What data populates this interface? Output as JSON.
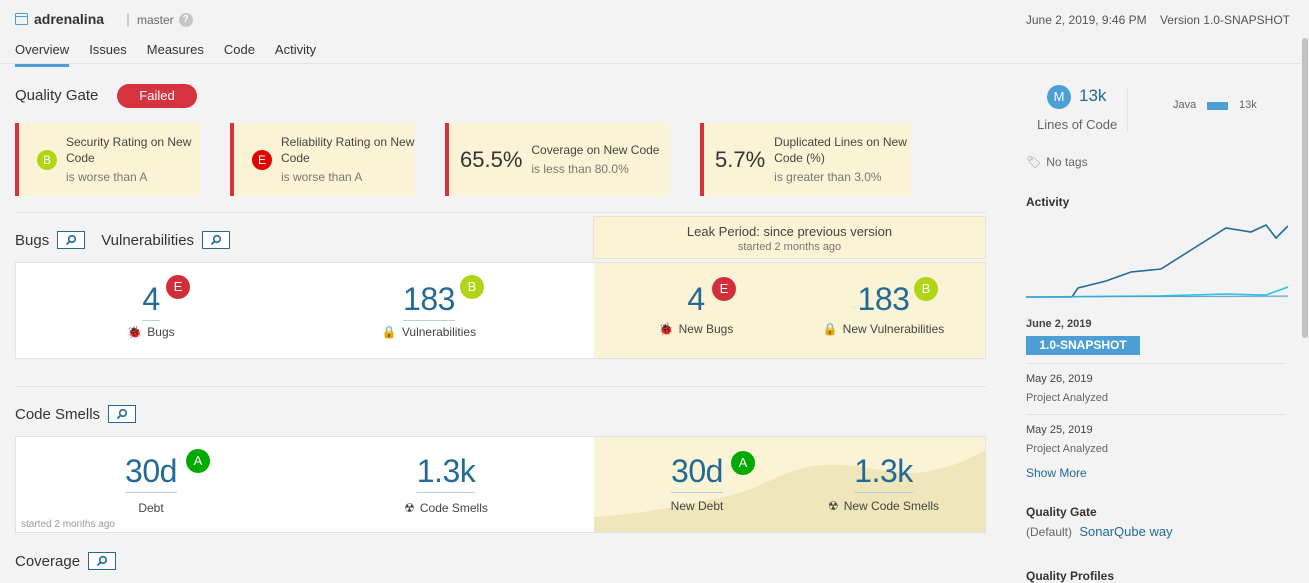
{
  "header": {
    "project_name": "adrenalina",
    "branch": "master",
    "date": "June 2, 2019, 9:46 PM",
    "version": "Version 1.0-SNAPSHOT"
  },
  "tabs": [
    {
      "label": "Overview",
      "active": true
    },
    {
      "label": "Issues"
    },
    {
      "label": "Measures"
    },
    {
      "label": "Code"
    },
    {
      "label": "Activity"
    }
  ],
  "quality_gate": {
    "title": "Quality Gate",
    "status": "Failed",
    "conditions": [
      {
        "badge": "B",
        "label": "Security Rating on New Code",
        "detail": "is worse than A"
      },
      {
        "badge": "E",
        "label": "Reliability Rating on New Code",
        "detail": "is worse than A"
      },
      {
        "value": "65.5%",
        "label": "Coverage on New Code",
        "detail": "is less than 80.0%"
      },
      {
        "value": "5.7%",
        "label": "Duplicated Lines on New Code (%)",
        "detail": "is greater than 3.0%"
      }
    ]
  },
  "leak_period": {
    "title": "Leak Period: since previous version",
    "subtitle": "started 2 months ago"
  },
  "bugs_section": {
    "bugs_title": "Bugs",
    "vuln_title": "Vulnerabilities",
    "bugs": {
      "value": "4",
      "rating": "E",
      "label": "Bugs"
    },
    "vulnerabilities": {
      "value": "183",
      "rating": "B",
      "label": "Vulnerabilities"
    },
    "new_bugs": {
      "value": "4",
      "rating": "E",
      "label": "New Bugs"
    },
    "new_vulnerabilities": {
      "value": "183",
      "rating": "B",
      "label": "New Vulnerabilities"
    }
  },
  "code_smells_section": {
    "title": "Code Smells",
    "debt": {
      "value": "30d",
      "rating": "A",
      "label": "Debt"
    },
    "code_smells": {
      "value": "1.3k",
      "label": "Code Smells"
    },
    "new_debt": {
      "value": "30d",
      "rating": "A",
      "label": "New Debt"
    },
    "new_code_smells": {
      "value": "1.3k",
      "label": "New Code Smells"
    },
    "started_note": "started 2 months ago"
  },
  "coverage_section": {
    "title": "Coverage"
  },
  "sidebar": {
    "loc_badge": "M",
    "loc_value": "13k",
    "loc_label": "Lines of Code",
    "language": {
      "name": "Java",
      "value": "13k"
    },
    "tags": "No tags",
    "activity_title": "Activity",
    "activity": [
      {
        "date": "June 2, 2019",
        "version": "1.0-SNAPSHOT"
      },
      {
        "date": "May 26, 2019",
        "event": "Project Analyzed"
      },
      {
        "date": "May 25, 2019",
        "event": "Project Analyzed"
      }
    ],
    "show_more": "Show More",
    "quality_gate_title": "Quality Gate",
    "quality_gate_default": "(Default)",
    "quality_gate_name": "SonarQube way",
    "quality_profiles_title": "Quality Profiles"
  },
  "colors": {
    "accent": "#4b9fd5",
    "failed": "#d4333f",
    "rating_a": "#00aa00",
    "rating_b": "#b0d513",
    "rating_e": "#d02f3a",
    "leak_bg": "#fbf3d5"
  }
}
